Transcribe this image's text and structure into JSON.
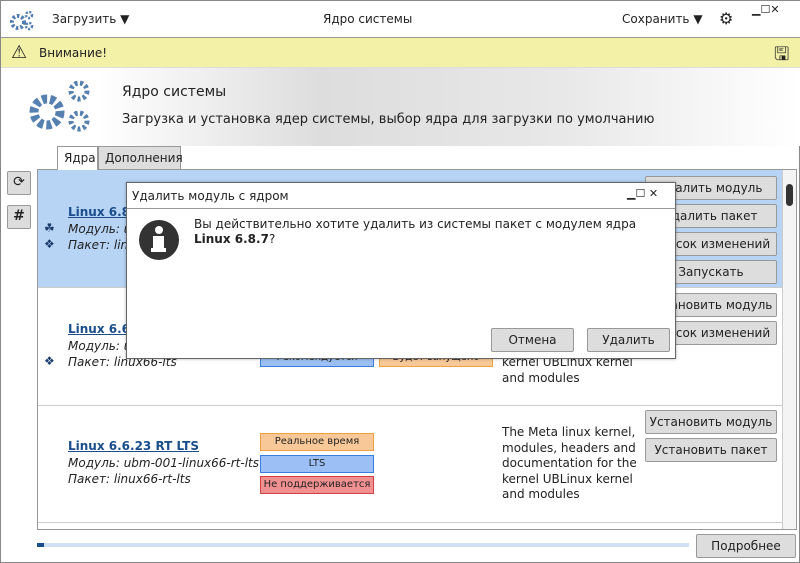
{
  "topbar": {
    "load": "Загрузить",
    "title": "Ядро системы",
    "save": "Сохранить"
  },
  "warning": {
    "text": "Внимание!"
  },
  "header": {
    "title": "Ядро системы",
    "subtitle": "Загрузка и установка ядер системы, выбор ядра для загрузки по умолчанию"
  },
  "tabs": [
    "Ядра",
    "Дополнения"
  ],
  "kernels": [
    {
      "name": "Linux 6.8.7",
      "module": "Модуль: u",
      "package": "Пакет: linu",
      "buttons": [
        "Удалить модуль",
        "Удалить пакет",
        "Список изменений",
        "Запускать"
      ]
    },
    {
      "name": "Linux 6.6.",
      "module": "Модуль: u",
      "package": "Пакет: linux66-lts",
      "badges": [
        "Рекомендуется",
        "Будет запущено"
      ],
      "desc": "kernel UBLinux kernel and modules",
      "buttons": [
        "Установить модуль",
        "Список изменений"
      ]
    },
    {
      "name": "Linux 6.6.23 RT LTS",
      "module": "Модуль: ubm-001-linux66-rt-lts",
      "package": "Пакет: linux66-rt-lts",
      "badges": [
        "Реальное время",
        "LTS",
        "Не поддерживается"
      ],
      "desc": "The Meta linux kernel, modules, headers and documentation for the kernel UBLinux kernel and modules",
      "buttons": [
        "Установить модуль",
        "Установить пакет"
      ]
    }
  ],
  "dialog": {
    "title": "Удалить модуль с ядром",
    "message": "Вы действительно хотите удалить из системы пакет с модулем ядра ",
    "message_bold": "Linux 6.8.7",
    "message_end": "?",
    "cancel": "Отмена",
    "delete": "Удалить"
  },
  "footer": {
    "progress": 0.01,
    "details": "Подробнее"
  }
}
